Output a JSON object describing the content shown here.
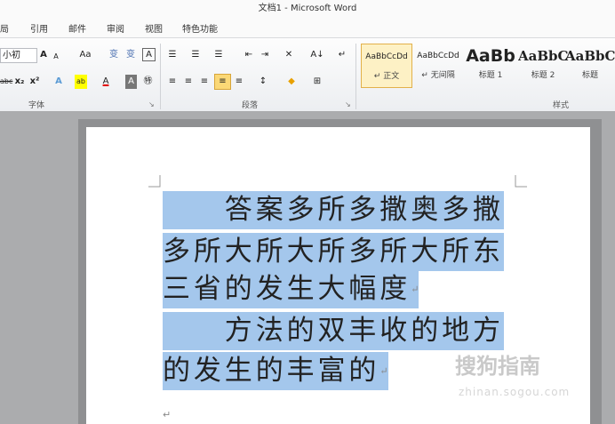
{
  "window": {
    "title": "文档1 - Microsoft Word"
  },
  "tabs": [
    "局",
    "引用",
    "邮件",
    "审阅",
    "视图",
    "特色功能"
  ],
  "font_group": {
    "size_value": "小初",
    "label": "字体",
    "row1": [
      "A",
      "A",
      "Aa",
      "变",
      "A"
    ],
    "row2": [
      "abc",
      "x₂",
      "x²",
      "A",
      "ab",
      "A",
      "A",
      "㊕"
    ]
  },
  "paragraph_group": {
    "label": "段落",
    "row1": [
      "☰",
      "☰",
      "☰",
      "⇤",
      "⇥",
      "✕",
      "A↓",
      "↵"
    ],
    "row2": [
      "≡",
      "≡",
      "≡",
      "≡",
      "≡",
      "↕",
      "◆",
      "⊞"
    ]
  },
  "styles_group": {
    "label": "样式",
    "items": [
      {
        "preview": "AaBbCcDd",
        "name": "↵ 正文"
      },
      {
        "preview": "AaBbCcDd",
        "name": "↵ 无间隔"
      },
      {
        "preview": "AaBb",
        "name": "标题 1"
      },
      {
        "preview": "AaBbC",
        "name": "标题 2"
      },
      {
        "preview": "AaBbC",
        "name": "标题"
      }
    ]
  },
  "document": {
    "lines": [
      {
        "text": "　　答案多所多撒奥多撒",
        "mark": ""
      },
      {
        "text": "多所大所大所多所大所东",
        "mark": ""
      },
      {
        "text": "三省的发生大幅度",
        "mark": "↵"
      },
      {
        "text": "　　方法的双丰收的地方",
        "mark": ""
      },
      {
        "text": "的发生的丰富的",
        "mark": "↵"
      }
    ],
    "trailing_mark": "↵"
  },
  "watermark": {
    "main": "搜狗指南",
    "sub": "zhinan.sogou.com"
  }
}
